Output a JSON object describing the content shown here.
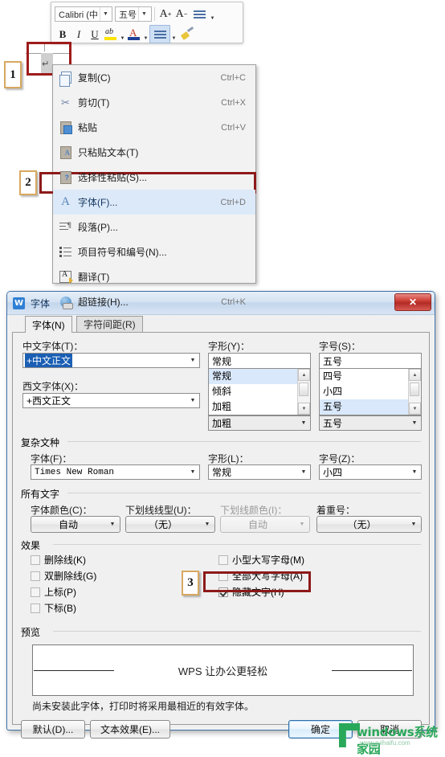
{
  "mini_toolbar": {
    "font_name": "Calibri (中",
    "font_size": "五号",
    "grow_font": "A",
    "shrink_font": "A",
    "line_spacing_icon": "line-spacing-icon",
    "bold": "B",
    "italic": "I",
    "underline": "U",
    "highlight_icon": "text-highlight-icon",
    "font_color_icon": "font-color-icon",
    "align_icon": "align-icon",
    "format_painter_icon": "format-painter-icon"
  },
  "document": {
    "paragraph_mark": "↵"
  },
  "annotations": {
    "step1": "1",
    "step2": "2",
    "step3": "3"
  },
  "context_menu": {
    "items": [
      {
        "label": "复制(C)",
        "shortcut": "Ctrl+C",
        "icon": "copy-icon",
        "selected": false
      },
      {
        "label": "剪切(T)",
        "shortcut": "Ctrl+X",
        "icon": "cut-icon",
        "selected": false
      },
      {
        "label": "粘贴",
        "shortcut": "Ctrl+V",
        "icon": "paste-icon",
        "selected": false
      },
      {
        "label": "只粘贴文本(T)",
        "shortcut": "",
        "icon": "paste-text-icon",
        "selected": false
      },
      {
        "label": "选择性粘贴(S)...",
        "shortcut": "",
        "icon": "paste-special-icon",
        "selected": false
      },
      {
        "label": "字体(F)...",
        "shortcut": "Ctrl+D",
        "icon": "font-icon",
        "selected": true
      },
      {
        "label": "段落(P)...",
        "shortcut": "",
        "icon": "paragraph-icon",
        "selected": false
      },
      {
        "label": "项目符号和编号(N)...",
        "shortcut": "",
        "icon": "bullets-numbering-icon",
        "selected": false
      },
      {
        "label": "翻译(T)",
        "shortcut": "",
        "icon": "translate-icon",
        "selected": false
      },
      {
        "label": "超链接(H)...",
        "shortcut": "Ctrl+K",
        "icon": "hyperlink-icon",
        "selected": false
      }
    ]
  },
  "dialog": {
    "title": "字体",
    "icon": "wps-logo-icon",
    "close_label": "✕",
    "tabs": [
      {
        "label": "字体(N)",
        "active": true
      },
      {
        "label": "字符间距(R)",
        "active": false
      }
    ],
    "latin_section": {
      "chinese_font_label": "中文字体(T)：",
      "chinese_font_value": "+中文正文",
      "western_font_label": "西文字体(X)：",
      "western_font_value": "+西文正文",
      "style_label": "字形(Y)：",
      "style_value": "常规",
      "style_options": [
        "常规",
        "倾斜",
        "加粗"
      ],
      "style_selected": "常规",
      "size_label": "字号(S)：",
      "size_value": "五号",
      "size_options": [
        "四号",
        "小四",
        "五号"
      ],
      "size_selected": "五号",
      "western_style_value": "加粗",
      "western_size_value": "五号"
    },
    "complex_section": {
      "group_label": "复杂文种",
      "font_label": "字体(F)：",
      "font_value": "Times New Roman",
      "style_label": "字形(L)：",
      "style_value": "常规",
      "size_label": "字号(Z)：",
      "size_value": "小四"
    },
    "all_text_section": {
      "group_label": "所有文字",
      "font_color_label": "字体颜色(C)：",
      "font_color_value": "自动",
      "underline_style_label": "下划线线型(U)：",
      "underline_style_value": "（无）",
      "underline_color_label": "下划线颜色(I)：",
      "underline_color_value": "自动",
      "emphasis_label": "着重号：",
      "emphasis_value": "（无）"
    },
    "effects_section": {
      "group_label": "效果",
      "left": [
        {
          "label": "删除线(K)",
          "checked": false
        },
        {
          "label": "双删除线(G)",
          "checked": false
        },
        {
          "label": "上标(P)",
          "checked": false
        },
        {
          "label": "下标(B)",
          "checked": false
        }
      ],
      "right": [
        {
          "label": "小型大写字母(M)",
          "checked": false
        },
        {
          "label": "全部大写字母(A)",
          "checked": false
        },
        {
          "label": "隐藏文字(H)",
          "checked": true
        }
      ]
    },
    "preview_section": {
      "group_label": "预览",
      "sample_text": "WPS 让办公更轻松",
      "note": "尚未安装此字体，打印时将采用最相近的有效字体。"
    },
    "buttons": {
      "default": "默认(D)...",
      "text_effects": "文本效果(E)...",
      "ok": "确定",
      "cancel": "取消"
    }
  },
  "watermark": {
    "text": "windows系统家园",
    "url": "www.ruihaifu.com"
  }
}
